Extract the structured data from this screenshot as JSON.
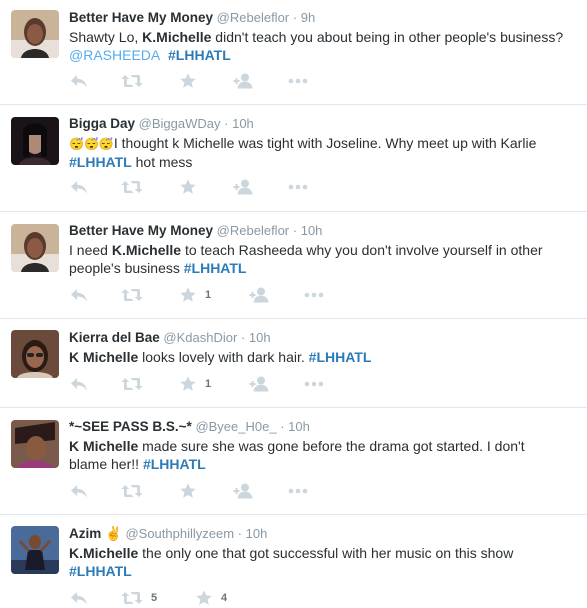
{
  "tweets": [
    {
      "name": "Better Have My Money",
      "handle": "@Rebeleflor",
      "time": "9h",
      "line1_pre": "Shawty Lo, ",
      "line1_kw": "K.Michelle",
      "line1_post": " didn't teach you about being in other people's business?",
      "line2_mention": "@RASHEEDA",
      "line2_tag": "#LHHATL",
      "favorites": ""
    },
    {
      "name": "Bigga Day",
      "handle": "@BiggaWDay",
      "time": "10h",
      "emoji": "😴😴😴",
      "line1": "I thought k Michelle was tight with Joseline. Why meet up with Karlie",
      "line2_tag": "#LHHATL",
      "line2_post": " hot mess",
      "favorites": ""
    },
    {
      "name": "Better Have My Money",
      "handle": "@Rebeleflor",
      "time": "10h",
      "line1_pre": "I need ",
      "line1_kw": "K.Michelle",
      "line1_post": " to teach Rasheeda why you don't involve yourself in other",
      "line2_pre": "people's business ",
      "line2_tag": "#LHHATL",
      "favorites": "1"
    },
    {
      "name": "Kierra del Bae",
      "handle": "@KdashDior",
      "time": "10h",
      "line1_kw": "K Michelle",
      "line1_post": " looks lovely with dark hair. ",
      "line1_tag": "#LHHATL",
      "favorites": "1"
    },
    {
      "name": "*~SEE PASS B.S.~*",
      "handle": "@Byee_H0e_",
      "time": "10h",
      "line1_kw": "K Michelle",
      "line1_post": " made sure she was gone before the drama got started. I don't",
      "line2_pre": "blame her!! ",
      "line2_tag": "#LHHATL",
      "favorites": ""
    },
    {
      "name": "Azim ✌",
      "handle": "@Southphillyzeem",
      "time": "10h",
      "line1_kw": "K.Michelle",
      "line1_post": " the only one that got successful with her music on this show",
      "line2_tag": "#LHHATL",
      "retweets": "5",
      "favorites": "4"
    }
  ],
  "sep": "·",
  "colors": {
    "name": "#292f33",
    "meta": "#8899a6",
    "hashtag": "#2b7bb9",
    "mention": "#55acee",
    "icon": "#ccd6dd"
  },
  "icons": [
    "reply-icon",
    "retweet-icon",
    "favorite-star-icon",
    "follow-user-icon",
    "more-options-icon"
  ]
}
